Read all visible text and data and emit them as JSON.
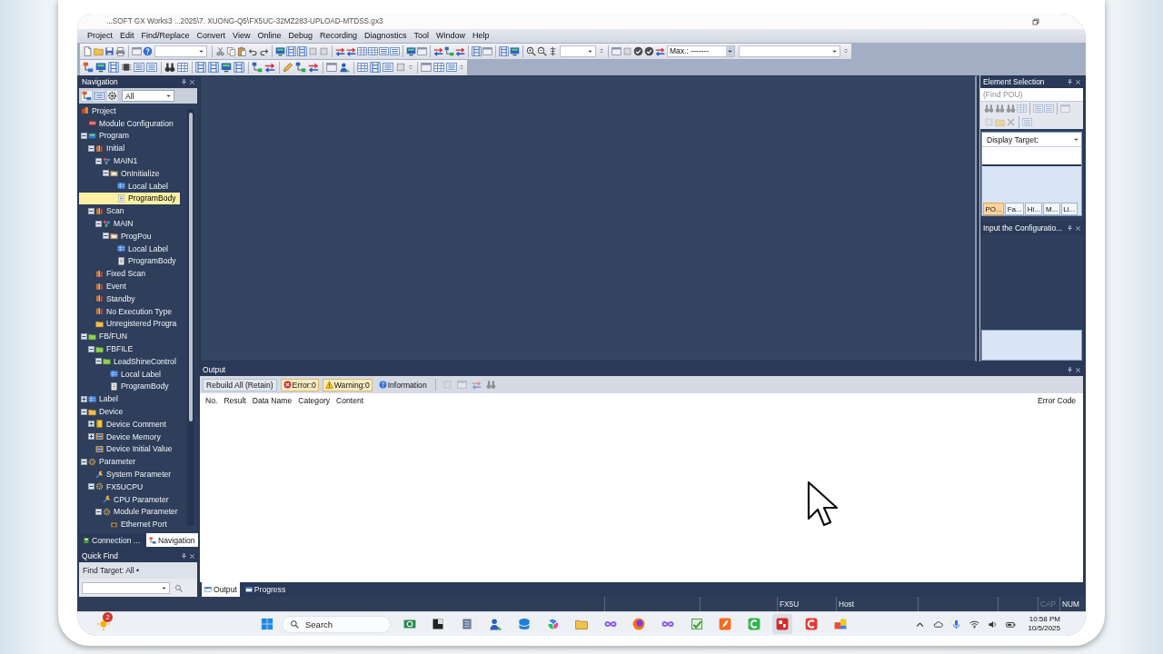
{
  "window": {
    "title": "...SOFT GX Works3 ...2025\\7. XUONG-Q5\\FX5UC-32MZ283-UPLOAD-MTDSS.gx3"
  },
  "menu": [
    "Project",
    "Edit",
    "Find/Replace",
    "Convert",
    "View",
    "Online",
    "Debug",
    "Recording",
    "Diagnostics",
    "Tool",
    "Window",
    "Help"
  ],
  "toolbar": {
    "monitor_range": "Max.: -------"
  },
  "navigation": {
    "title": "Navigation",
    "filter": "All",
    "tree": [
      {
        "label": "Project",
        "kind": "project",
        "selected": false,
        "children": [
          {
            "label": "Module Configuration",
            "kind": "module",
            "selected": false
          },
          {
            "label": "Program",
            "kind": "program",
            "selected": false,
            "expanded": true,
            "children": [
              {
                "label": "Initial",
                "kind": "task",
                "selected": false,
                "expanded": true,
                "children": [
                  {
                    "label": "MAIN1",
                    "kind": "pou",
                    "selected": false,
                    "expanded": true,
                    "children": [
                      {
                        "label": "OnInitialize",
                        "kind": "object",
                        "selected": false,
                        "expanded": true,
                        "children": [
                          {
                            "label": "Local Label",
                            "kind": "label",
                            "selected": false
                          },
                          {
                            "label": "ProgramBody",
                            "kind": "body",
                            "selected": true
                          }
                        ]
                      }
                    ]
                  }
                ]
              },
              {
                "label": "Scan",
                "kind": "task",
                "selected": false,
                "expanded": true,
                "children": [
                  {
                    "label": "MAIN",
                    "kind": "pou",
                    "selected": false,
                    "expanded": true,
                    "children": [
                      {
                        "label": "ProgPou",
                        "kind": "object",
                        "selected": false,
                        "expanded": true,
                        "children": [
                          {
                            "label": "Local Label",
                            "kind": "label",
                            "selected": false
                          },
                          {
                            "label": "ProgramBody",
                            "kind": "body",
                            "selected": false
                          }
                        ]
                      }
                    ]
                  }
                ]
              },
              {
                "label": "Fixed Scan",
                "kind": "task",
                "selected": false
              },
              {
                "label": "Event",
                "kind": "task",
                "selected": false
              },
              {
                "label": "Standby",
                "kind": "task",
                "selected": false
              },
              {
                "label": "No Execution Type",
                "kind": "task",
                "selected": false
              },
              {
                "label": "Unregistered Progra",
                "kind": "folder",
                "selected": false
              }
            ]
          },
          {
            "label": "FB/FUN",
            "kind": "fb",
            "selected": false,
            "expanded": true,
            "children": [
              {
                "label": "FBFILE",
                "kind": "fb",
                "selected": false,
                "expanded": true,
                "children": [
                  {
                    "label": "LeadShineControl",
                    "kind": "fb",
                    "selected": false,
                    "expanded": true,
                    "children": [
                      {
                        "label": "Local Label",
                        "kind": "label",
                        "selected": false
                      },
                      {
                        "label": "ProgramBody",
                        "kind": "body",
                        "selected": false
                      }
                    ]
                  }
                ]
              }
            ]
          },
          {
            "label": "Label",
            "kind": "label",
            "selected": false,
            "expanded": false
          },
          {
            "label": "Device",
            "kind": "folder",
            "selected": false,
            "expanded": true,
            "children": [
              {
                "label": "Device Comment",
                "kind": "book",
                "selected": false,
                "expanded": false
              },
              {
                "label": "Device Memory",
                "kind": "memory",
                "selected": false,
                "expanded": false
              },
              {
                "label": "Device Initial Value",
                "kind": "memory",
                "selected": false
              }
            ]
          },
          {
            "label": "Parameter",
            "kind": "parameter",
            "selected": false,
            "expanded": true,
            "children": [
              {
                "label": "System Parameter",
                "kind": "setting",
                "selected": false
              },
              {
                "label": "FX5UCPU",
                "kind": "parameter",
                "selected": false,
                "expanded": true,
                "children": [
                  {
                    "label": "CPU Parameter",
                    "kind": "setting",
                    "selected": false
                  },
                  {
                    "label": "Module Parameter",
                    "kind": "parameter",
                    "selected": false,
                    "expanded": true,
                    "children": [
                      {
                        "label": "Ethernet Port",
                        "kind": "port",
                        "selected": false
                      }
                    ]
                  }
                ]
              }
            ]
          }
        ]
      }
    ],
    "tabs": [
      {
        "label": "Connection ...",
        "kind": "connection",
        "selected": false
      },
      {
        "label": "Navigation",
        "kind": "navigation",
        "selected": true
      }
    ]
  },
  "quick_find": {
    "title": "Quick Find",
    "target": "Find Target: All •"
  },
  "element_selection": {
    "title": "Element Selection",
    "search": {
      "placeholder": "(Find POU)"
    },
    "display_target": "Display Target:",
    "tabs": [
      {
        "label": "PO...",
        "selected": true
      },
      {
        "label": "Fa...",
        "selected": false
      },
      {
        "label": "Hi...",
        "selected": false
      },
      {
        "label": "M...",
        "selected": false
      },
      {
        "label": "Li...",
        "selected": false
      }
    ]
  },
  "configuration_panel": {
    "title": "Input the Configuratio..."
  },
  "output": {
    "title": "Output",
    "action": "Rebuild All (Retain)",
    "filters": [
      {
        "label": "Error:0",
        "kind": "error",
        "on": true
      },
      {
        "label": "Warning:0",
        "kind": "warning",
        "on": true
      },
      {
        "label": "Information",
        "kind": "info",
        "on": false
      }
    ],
    "columns": [
      "No.",
      "Result",
      "Data Name",
      "Category",
      "Content",
      "Error Code"
    ],
    "tabs": [
      {
        "label": "Output",
        "selected": true
      },
      {
        "label": "Progress",
        "selected": false
      }
    ]
  },
  "status_bar": [
    {
      "text": "FX5U",
      "disabled": false
    },
    {
      "text": "Host",
      "disabled": false
    },
    {
      "text": "CAP",
      "disabled": true
    },
    {
      "text": "NUM",
      "disabled": false
    }
  ],
  "taskbar": {
    "badge": "2",
    "search": {
      "placeholder": "Search"
    },
    "apps": [
      {
        "selected": false
      },
      {
        "selected": false
      },
      {
        "selected": false
      },
      {
        "selected": false
      },
      {
        "selected": false
      },
      {
        "selected": false
      },
      {
        "selected": false
      },
      {
        "selected": false
      },
      {
        "selected": false
      },
      {
        "selected": false
      },
      {
        "selected": false
      },
      {
        "selected": false
      },
      {
        "selected": false
      },
      {
        "selected": true
      },
      {
        "selected": false
      },
      {
        "selected": false
      }
    ],
    "time": "10:58 PM",
    "date": "10/5/2025"
  }
}
